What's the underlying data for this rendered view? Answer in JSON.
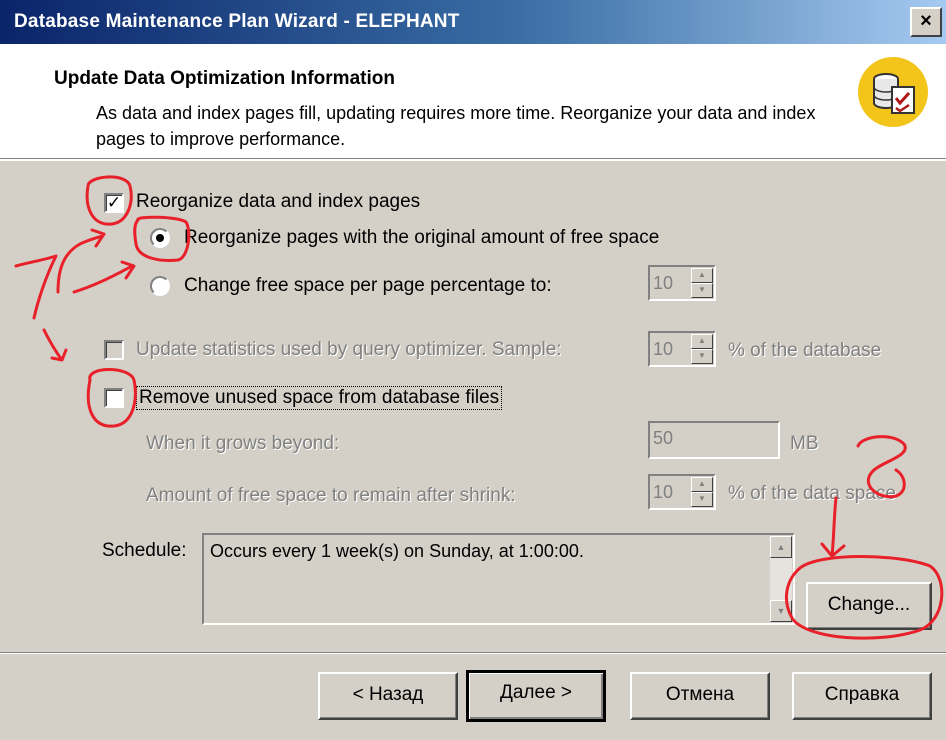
{
  "window": {
    "title": "Database Maintenance Plan Wizard - ELEPHANT",
    "close_label": "×"
  },
  "header": {
    "title": "Update Data Optimization Information",
    "description": "As data and index pages fill, updating requires more time. Reorganize your data and index pages to improve performance.",
    "icon": "database-checklist-icon"
  },
  "options": {
    "reorganize": {
      "label": "Reorganize data and index pages",
      "checked": true
    },
    "keep_free_space": {
      "label": "Reorganize pages with the original amount of free space",
      "selected": true
    },
    "change_free_space": {
      "label": "Change free space per page percentage to:",
      "selected": false,
      "value": "10"
    },
    "update_stats": {
      "label": "Update statistics used by query optimizer. Sample:",
      "checked": false,
      "enabled": false,
      "value": "10",
      "suffix": "% of the database"
    },
    "remove_unused": {
      "label": "Remove unused space from database files",
      "checked": false
    },
    "grows_beyond": {
      "label": "When it grows beyond:",
      "value": "50",
      "unit": "MB"
    },
    "free_after_shrink": {
      "label": "Amount of free space to remain after shrink:",
      "value": "10",
      "suffix": "% of the data space"
    }
  },
  "schedule": {
    "label": "Schedule:",
    "text": "Occurs every 1 week(s) on Sunday, at 1:00:00.",
    "change_label": "Change..."
  },
  "footer": {
    "back_label": "< Назад",
    "next_label": "Далее >",
    "cancel_label": "Отмена",
    "help_label": "Справка"
  },
  "annotations": {
    "color": "#e8202a",
    "marks": [
      "7",
      "8"
    ]
  }
}
